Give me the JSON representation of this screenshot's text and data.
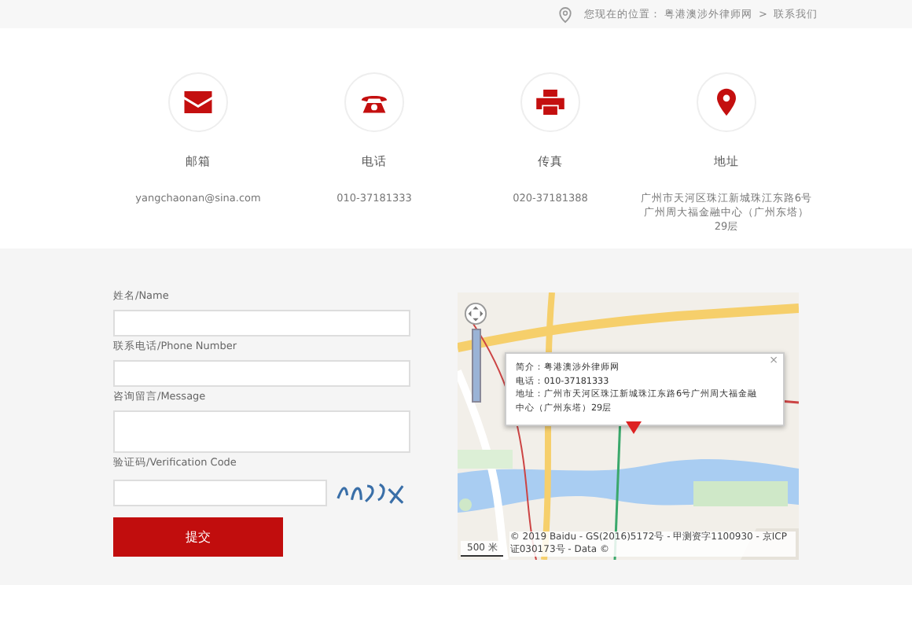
{
  "breadcrumb": {
    "prefix": "您现在的位置：",
    "items": [
      "粤港澳涉外律师网",
      "联系我们"
    ],
    "separator": ">"
  },
  "contacts": [
    {
      "kind": "mail",
      "label": "邮箱",
      "value": "yangchaonan@sina.com"
    },
    {
      "kind": "phone",
      "label": "电话",
      "value": "010-37181333"
    },
    {
      "kind": "fax",
      "label": "传真",
      "value": "020-37181388"
    },
    {
      "kind": "location",
      "label": "地址",
      "value": "广州市天河区珠江新城珠江东路6号广州周大福金融中心（广州东塔）29层"
    }
  ],
  "form": {
    "fields": [
      {
        "kind": "input",
        "label": "姓名/Name"
      },
      {
        "kind": "input",
        "label": "联系电话/Phone Number"
      },
      {
        "kind": "textarea",
        "label": "咨询留言/Message"
      },
      {
        "kind": "captcha",
        "label": "验证码/Verification Code"
      }
    ],
    "submit": "提交"
  },
  "map": {
    "popup": {
      "close": "×",
      "lines": [
        "简介：粤港澳涉外律师网",
        "电话：010-37181333",
        "地址：广州市天河区珠江新城珠江东路6号广州周大福金融中心（广州东塔）29层"
      ]
    },
    "scale": "500 米",
    "copyright": "© 2019 Baidu - GS(2016)5172号 - 甲测资字1100930 - 京ICP证030173号 - Data ©"
  }
}
